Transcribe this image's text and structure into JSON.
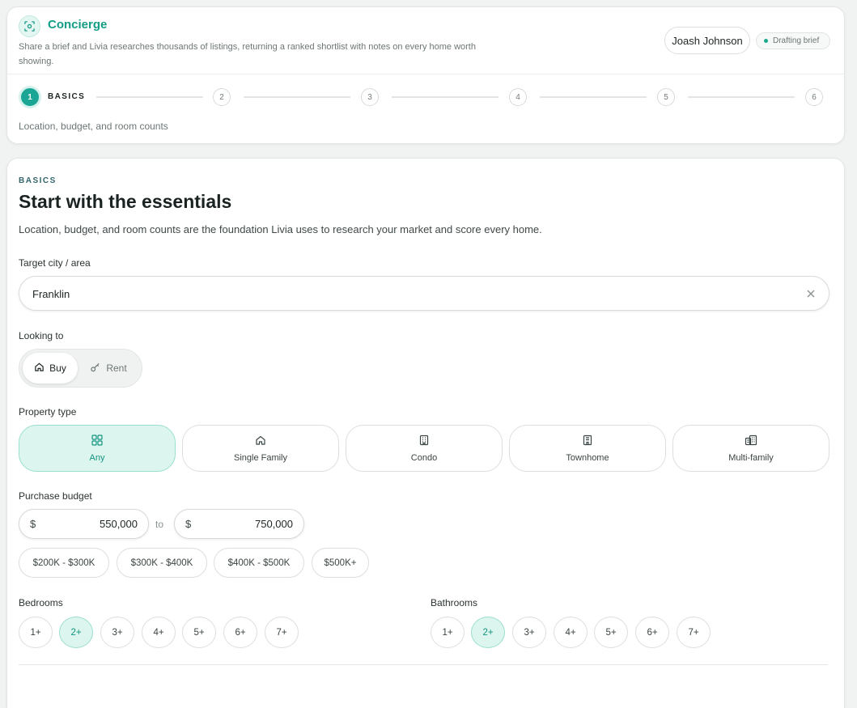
{
  "header": {
    "app_title": "Concierge",
    "icon": "concierge-scan-icon",
    "description": "Share a brief and Livia researches thousands of listings, returning a ranked shortlist with notes on every home worth showing.",
    "user_name": "Joash Johnson",
    "status": "Drafting brief",
    "status_color": "#1aa98f"
  },
  "stepper": {
    "steps": [
      "1",
      "2",
      "3",
      "4",
      "5",
      "6"
    ],
    "active_step": 1,
    "active_label": "BASICS",
    "subtitle": "Location, budget, and room counts"
  },
  "main": {
    "eyebrow": "BASICS",
    "title": "Start with the essentials",
    "lead": "Location, budget, and room counts are the foundation Livia uses to research your market and score every home.",
    "city": {
      "label": "Target city / area",
      "value": "Franklin"
    },
    "looking_to": {
      "label": "Looking to",
      "options": [
        {
          "label": "Buy",
          "icon": "home-icon",
          "selected": true
        },
        {
          "label": "Rent",
          "icon": "key-icon",
          "selected": false
        }
      ]
    },
    "property_type": {
      "label": "Property type",
      "options": [
        {
          "label": "Any",
          "icon": "grid-icon",
          "selected": true
        },
        {
          "label": "Single Family",
          "icon": "house-icon",
          "selected": false
        },
        {
          "label": "Condo",
          "icon": "building-icon",
          "selected": false
        },
        {
          "label": "Townhome",
          "icon": "townhome-icon",
          "selected": false
        },
        {
          "label": "Multi-family",
          "icon": "multi-family-icon",
          "selected": false
        }
      ]
    },
    "budget": {
      "label": "Purchase budget",
      "currency": "$",
      "min": "550,000",
      "separator": "to",
      "max": "750,000",
      "presets": [
        "$200K - $300K",
        "$300K - $400K",
        "$400K - $500K",
        "$500K+"
      ]
    },
    "bedrooms": {
      "label": "Bedrooms",
      "options": [
        "1+",
        "2+",
        "3+",
        "4+",
        "5+",
        "6+",
        "7+"
      ],
      "selected": "2+"
    },
    "bathrooms": {
      "label": "Bathrooms",
      "options": [
        "1+",
        "2+",
        "3+",
        "4+",
        "5+",
        "6+",
        "7+"
      ],
      "selected": "2+"
    }
  },
  "colors": {
    "accent": "#1ba594",
    "accent_soft": "#dcf6ef",
    "title_accent": "#149c86"
  }
}
